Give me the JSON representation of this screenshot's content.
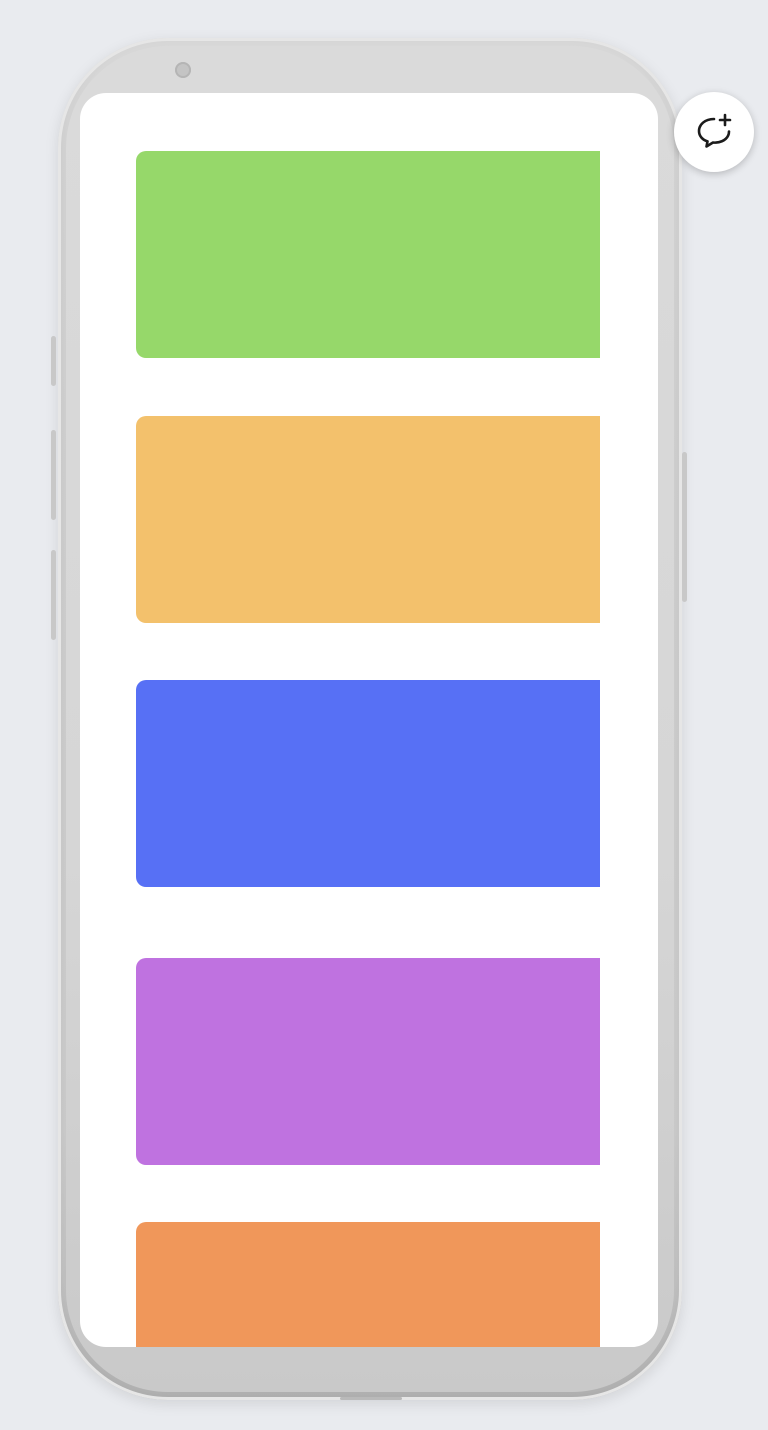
{
  "device": {
    "frame_color": "#d5d5d5",
    "screen_color": "#ffffff"
  },
  "cards": [
    {
      "name": "green-card",
      "color": "#96d86a"
    },
    {
      "name": "yellow-card",
      "color": "#f3c16c"
    },
    {
      "name": "blue-card",
      "color": "#5770f5"
    },
    {
      "name": "purple-card",
      "color": "#bf72e0"
    },
    {
      "name": "orange-card",
      "color": "#f0975a"
    }
  ],
  "fab": {
    "icon": "add-comment-icon",
    "color": "#1b1b1b"
  }
}
